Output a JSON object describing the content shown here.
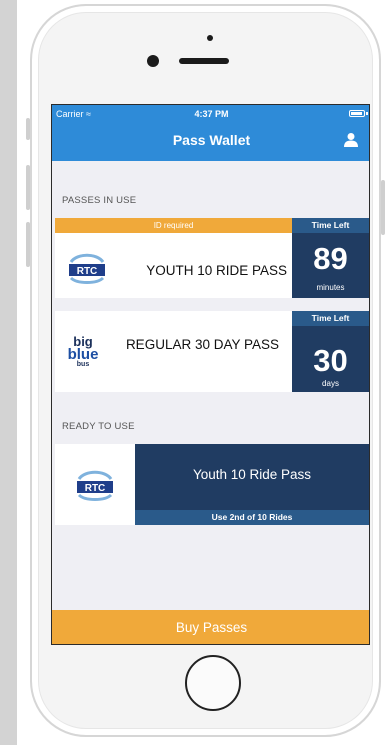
{
  "status_bar": {
    "carrier": "Carrier",
    "time": "4:37 PM"
  },
  "navbar": {
    "title": "Pass Wallet",
    "profile_icon": "user-icon"
  },
  "passes_in_use": {
    "section_label": "PASSES IN USE",
    "passes": [
      {
        "agency": "RTC",
        "id_notice": "ID required",
        "name": "YOUTH 10 RIDE PASS",
        "time_label": "Time Left",
        "time_value": "89",
        "time_unit": "minutes"
      },
      {
        "agency_logo_text": [
          "big",
          "blue",
          "bus"
        ],
        "name": "REGULAR 30 DAY PASS",
        "time_label": "Time Left",
        "time_value": "30",
        "time_unit": "days"
      }
    ]
  },
  "ready_to_use": {
    "section_label": "READY TO USE",
    "pass": {
      "agency": "RTC",
      "name": "Youth 10 Ride Pass",
      "rides_note": "Use 2nd of 10 Rides"
    }
  },
  "footer": {
    "buy_label": "Buy Passes"
  },
  "colors": {
    "nav_blue": "#2e8bd8",
    "accent_orange": "#f0a93a",
    "dark_navy": "#203c62"
  }
}
